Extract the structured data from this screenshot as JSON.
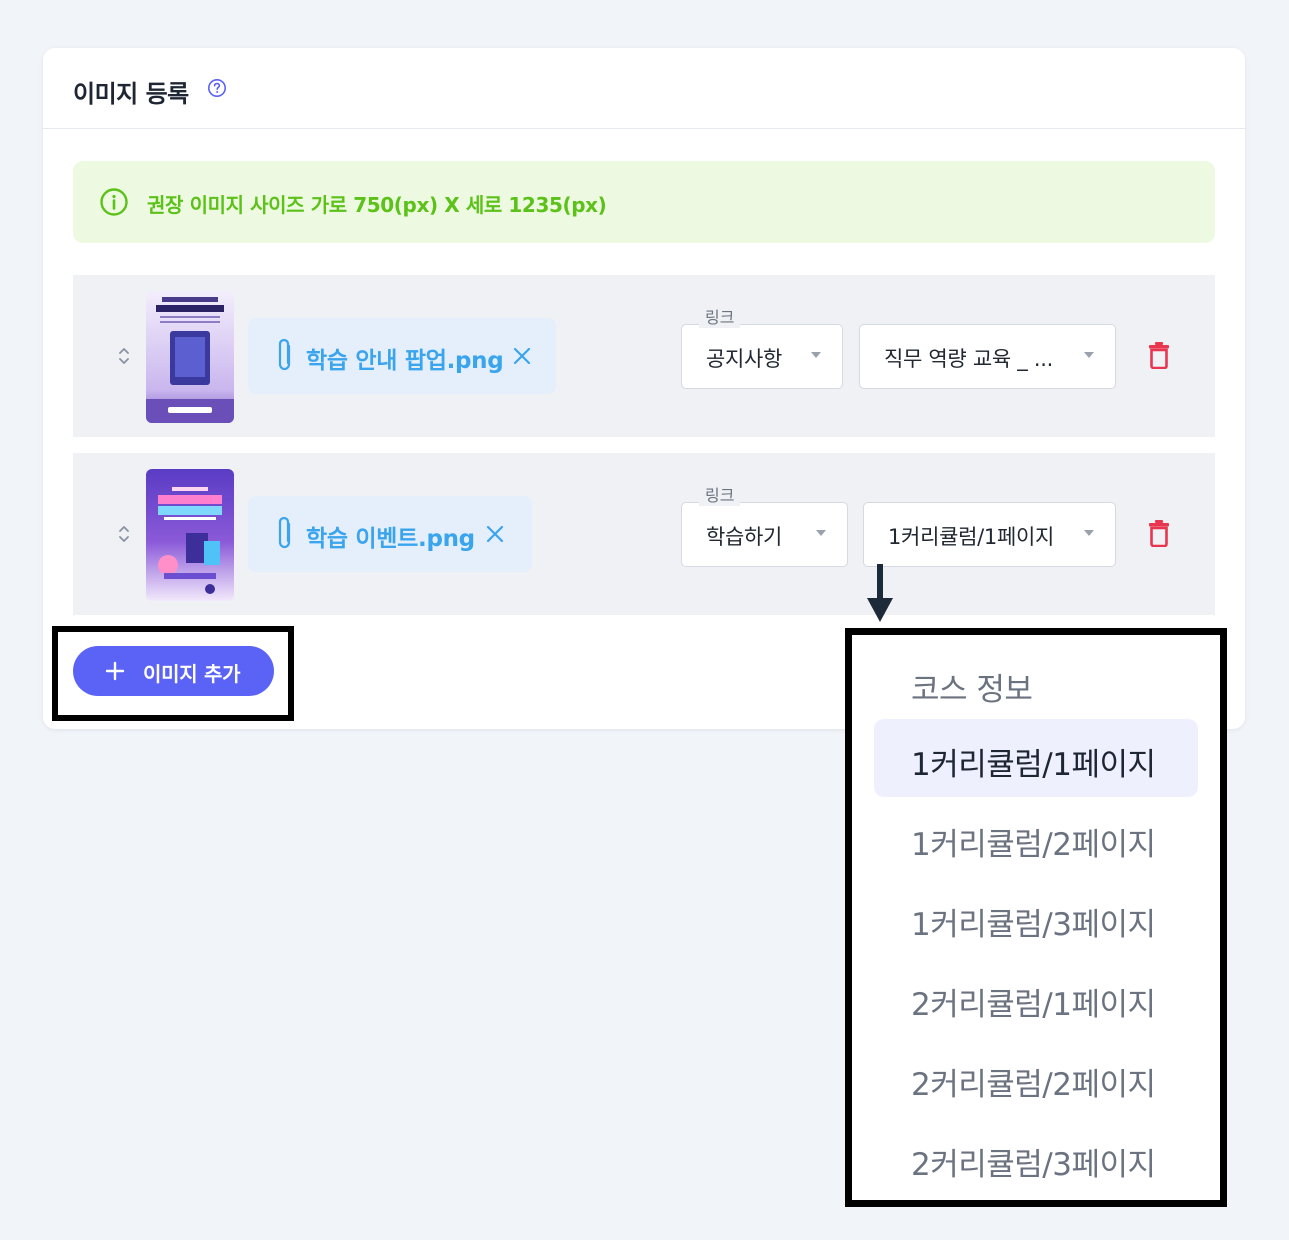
{
  "section": {
    "title": "이미지 등록",
    "help_icon": "question-circle-icon"
  },
  "notice": {
    "icon": "info-circle-icon",
    "text": "권장 이미지 사이즈 가로 750(px) X 세로 1235(px)",
    "color": "#5cc21a"
  },
  "rows": [
    {
      "file_name": "학습 안내 팝업.png",
      "link_label": "링크",
      "link_type": "공지사항",
      "link_target": "직무 역량 교육 _ ..."
    },
    {
      "file_name": "학습 이벤트.png",
      "link_label": "링크",
      "link_type": "학습하기",
      "link_target": "1커리큘럼/1페이지"
    }
  ],
  "add_button": {
    "label": "이미지 추가",
    "color": "#5a63f5"
  },
  "dropdown": {
    "selected": "1커리큘럼/1페이지",
    "options": [
      "코스 정보",
      "1커리큘럼/1페이지",
      "1커리큘럼/2페이지",
      "1커리큘럼/3페이지",
      "2커리큘럼/1페이지",
      "2커리큘럼/2페이지",
      "2커리큘럼/3페이지"
    ]
  },
  "colors": {
    "accent": "#5a63f5",
    "file_text": "#3aa4ee",
    "delete": "#e8364f",
    "highlight_outline": "#000000"
  }
}
